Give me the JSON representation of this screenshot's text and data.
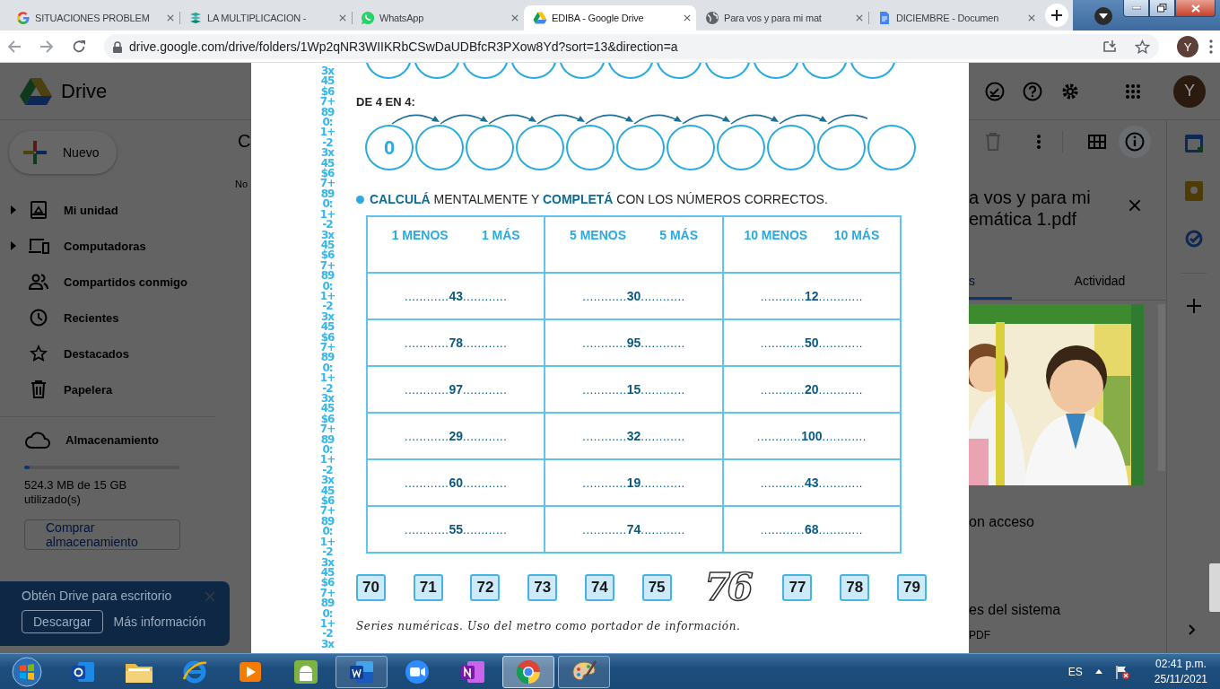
{
  "browser": {
    "tabs": [
      {
        "title": "SITUACIONES PROBLEM",
        "selected": false
      },
      {
        "title": "LA MULTIPLICACION -",
        "selected": false
      },
      {
        "title": "WhatsApp",
        "selected": false
      },
      {
        "title": "EDIBA - Google Drive",
        "selected": true
      },
      {
        "title": "Para vos y para mi mat",
        "selected": false
      },
      {
        "title": "DICIEMBRE - Documen",
        "selected": false
      }
    ],
    "url": "drive.google.com/drive/folders/1Wp2qNR3WIIKRbCSwDaUDBfcR3PXow8Yd?sort=13&direction=a",
    "profile_initial": "Y"
  },
  "drive": {
    "app_name": "Drive",
    "avatar_initial": "Y",
    "new_button": "Nuevo",
    "nav": [
      {
        "label": "Mi unidad",
        "expandable": true
      },
      {
        "label": "Computadoras",
        "expandable": true
      },
      {
        "label": "Compartidos conmigo",
        "expandable": false
      },
      {
        "label": "Recientes",
        "expandable": false
      },
      {
        "label": "Destacados",
        "expandable": false
      },
      {
        "label": "Papelera",
        "expandable": false
      }
    ],
    "storage": {
      "label": "Almacenamiento",
      "level": 0.035,
      "usage": "524.3 MB de 15 GB utilizado(s)",
      "buy_button": "Comprar almacenamiento"
    },
    "promo": {
      "title": "Obtén Drive para escritorio",
      "download_button": "Descargar",
      "more_link": "Más información"
    },
    "list": {
      "heading": "C",
      "column_header": "No"
    },
    "details": {
      "title_lines": [
        "a vos y para mi",
        "emática 1.pdf"
      ],
      "tabs": [
        {
          "label": "s",
          "selected": true
        },
        {
          "label": "Actividad",
          "selected": false
        }
      ],
      "thumbnail": {
        "kind": "picture"
      },
      "sections": [
        "on acceso",
        "es del sistema"
      ],
      "file_type": "PDF"
    }
  },
  "document": {
    "border_pattern": [
      "3x 45 $6 7+ 89 0: 1+ -2",
      "3x 45 $6 7+ 89 0: 1+ -2",
      "3x 45 $6 7+ 89 0: 1+ -2",
      "3x 45 $6 7+ 89 0: 1+ -2",
      "3x 45 $6 7+ 89 0: 1+ -2",
      "3x 45 $6 7+ 89 0: 1+ -2",
      "3x 45 $6 7+ 89 0: 1+ -2",
      "3x"
    ],
    "series_label": "DE 4 EN 4:",
    "series_circles": [
      {
        "kind": "filled",
        "value": "0"
      },
      {
        "kind": "blank"
      },
      {
        "kind": "blank"
      },
      {
        "kind": "blank"
      },
      {
        "kind": "blank"
      },
      {
        "kind": "blank"
      },
      {
        "kind": "blank"
      },
      {
        "kind": "blank"
      },
      {
        "kind": "blank"
      },
      {
        "kind": "blank"
      },
      {
        "kind": "blank"
      }
    ],
    "instruction": "**CALCULÁ** MENTALMENTE Y **COMPLETÁ** CON LOS NÚMEROS CORRECTOS.",
    "table": {
      "columns": [
        {
          "left": "1 MENOS",
          "right": "1 MÁS"
        },
        {
          "left": "5 MENOS",
          "right": "5 MÁS"
        },
        {
          "left": "10 MENOS",
          "right": "10 MÁS"
        }
      ],
      "rows": [
        [
          "............**43**............",
          "............**30**............",
          "............**12**............"
        ],
        [
          "............**78**............",
          "............**95**............",
          "............**50**............"
        ],
        [
          "............**97**............",
          "............**15**............",
          "............**20**............"
        ],
        [
          "............**29**............",
          "............**32**............",
          "............**100**............"
        ],
        [
          "............**60**............",
          "............**19**............",
          "............**43**............"
        ],
        [
          "............**55**............",
          "............**74**............",
          "............**68**............"
        ]
      ]
    },
    "number_line": [
      {
        "label": "70",
        "kind": "box"
      },
      {
        "label": "71",
        "kind": "box"
      },
      {
        "label": "72",
        "kind": "box"
      },
      {
        "label": "73",
        "kind": "box"
      },
      {
        "label": "74",
        "kind": "box"
      },
      {
        "label": "75",
        "kind": "box"
      },
      {
        "label": "76",
        "kind": "outlined"
      },
      {
        "label": "77",
        "kind": "box"
      },
      {
        "label": "78",
        "kind": "box"
      },
      {
        "label": "79",
        "kind": "box"
      }
    ],
    "caption": "Series numéricas. Uso del metro como portador de información."
  },
  "taskbar": {
    "apps": [
      {
        "running": false,
        "selected": false
      },
      {
        "running": false,
        "selected": false
      },
      {
        "running": false,
        "selected": false
      },
      {
        "running": false,
        "selected": false
      },
      {
        "running": false,
        "selected": false
      },
      {
        "running": true,
        "selected": false
      },
      {
        "running": false,
        "selected": false
      },
      {
        "running": false,
        "selected": false
      },
      {
        "running": true,
        "selected": true
      },
      {
        "running": true,
        "selected": false
      }
    ],
    "language": "ES",
    "time": "02:41 p.m.",
    "date": "25/11/2021"
  }
}
